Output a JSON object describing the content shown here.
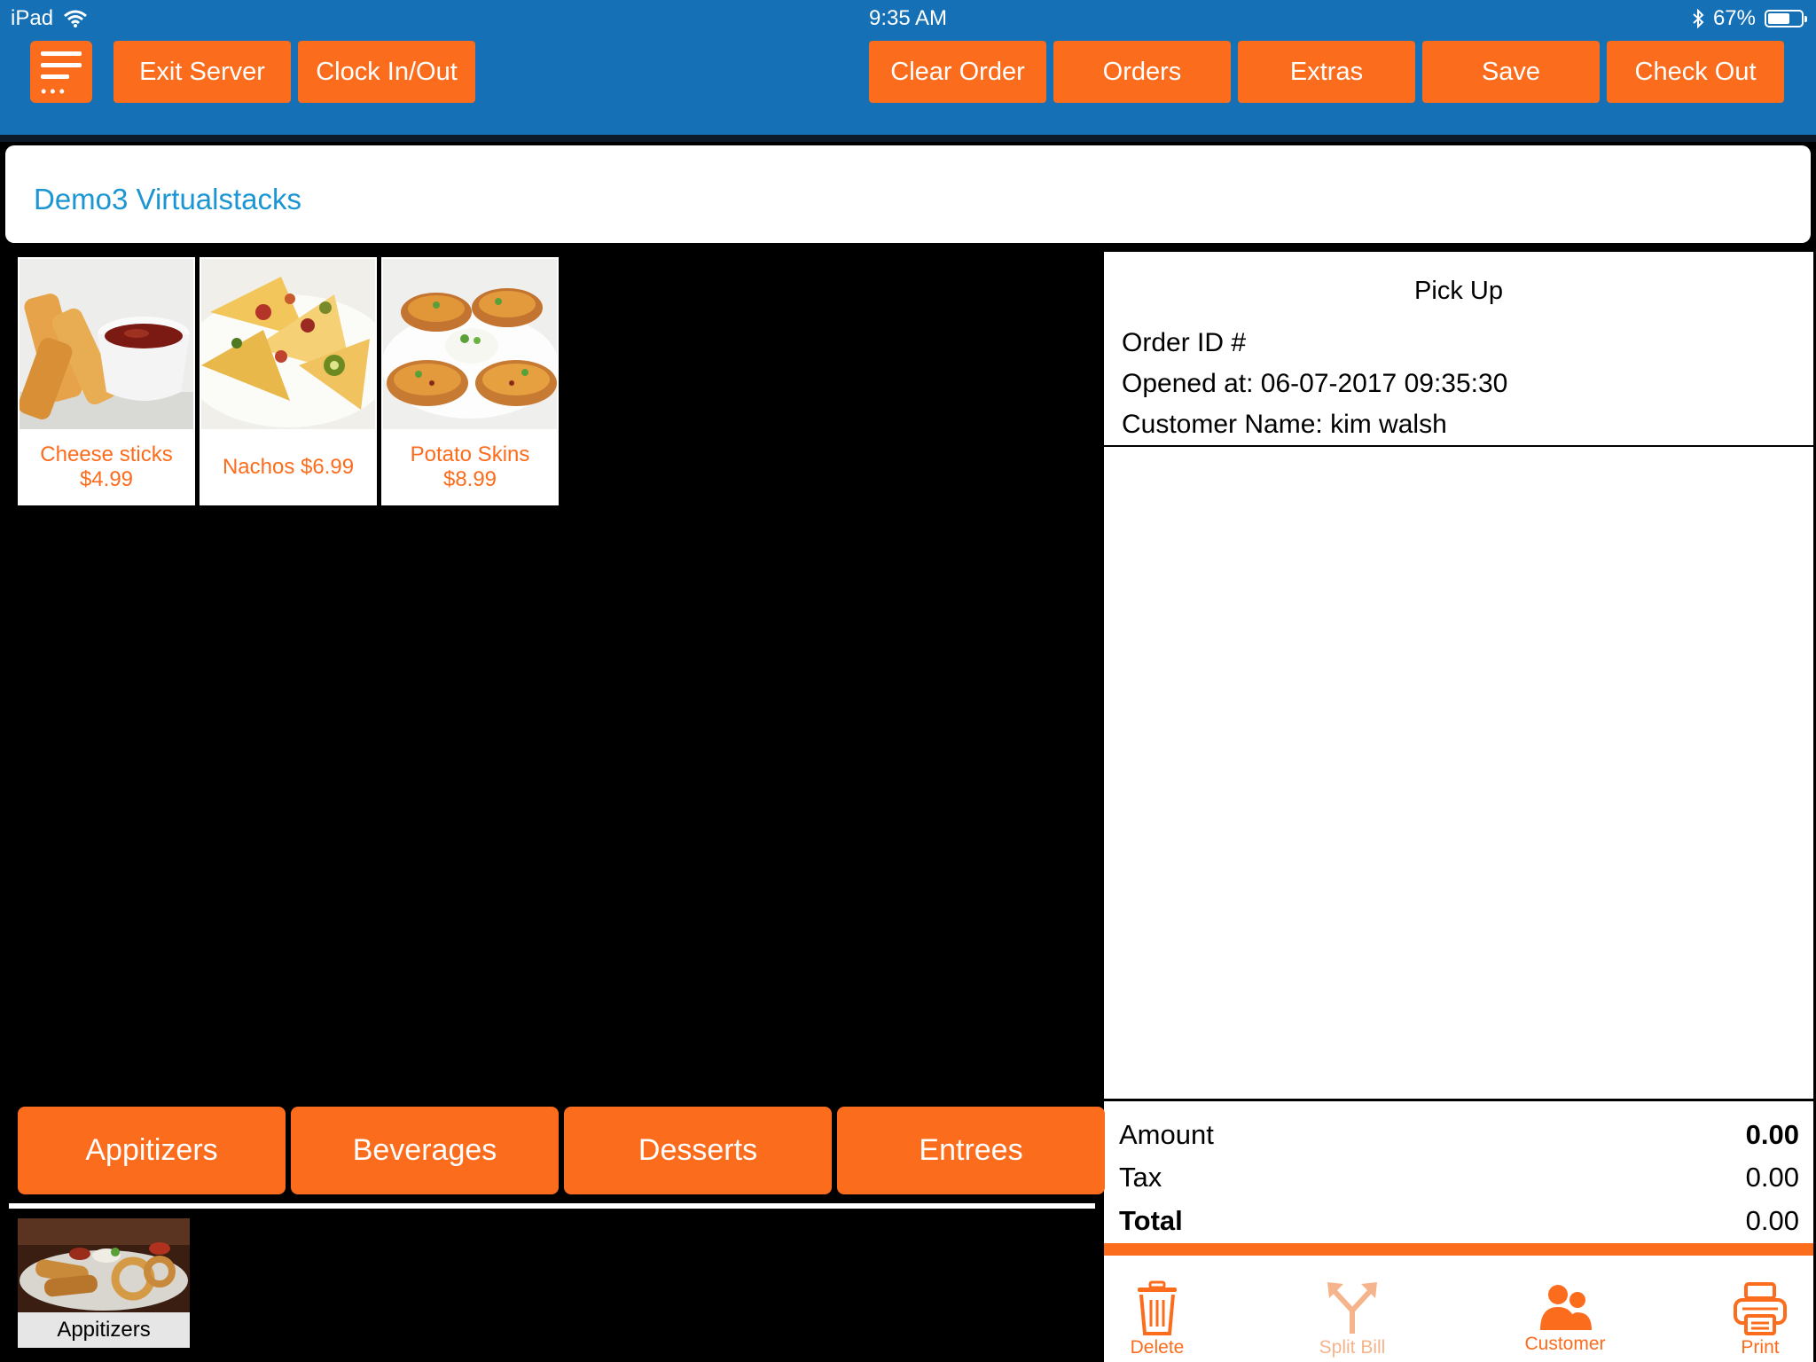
{
  "status_bar": {
    "device": "iPad",
    "time": "9:35 AM",
    "battery": "67%",
    "battery_level": 0.67
  },
  "toolbar": {
    "exit_server": "Exit Server",
    "clock": "Clock In/Out",
    "clear_order": "Clear Order",
    "orders": "Orders",
    "extras": "Extras",
    "save": "Save",
    "check_out": "Check Out"
  },
  "store": {
    "name": "Demo3 Virtualstacks"
  },
  "products": [
    {
      "name": "Cheese sticks",
      "price": "$4.99"
    },
    {
      "name": "Nachos $6.99"
    },
    {
      "name": "Potato Skins",
      "price": "$8.99"
    }
  ],
  "order": {
    "type": "Pick Up",
    "order_id": "Order ID #",
    "opened_at": "Opened at: 06-07-2017 09:35:30",
    "customer": "Customer Name: kim walsh",
    "amount_label": "Amount",
    "amount_value": "0.00",
    "tax_label": "Tax",
    "tax_value": "0.00",
    "total_label": "Total",
    "total_value": "0.00"
  },
  "actions": {
    "delete": "Delete",
    "split": "Split Bill",
    "customer": "Customer",
    "print": "Print"
  },
  "categories": [
    "Appitizers",
    "Beverages",
    "Desserts",
    "Entrees"
  ],
  "selected_category": {
    "label": "Appitizers"
  },
  "colors": {
    "accent": "#fb6c1d",
    "bar": "#1570b6",
    "store_name": "#1b96d3"
  }
}
